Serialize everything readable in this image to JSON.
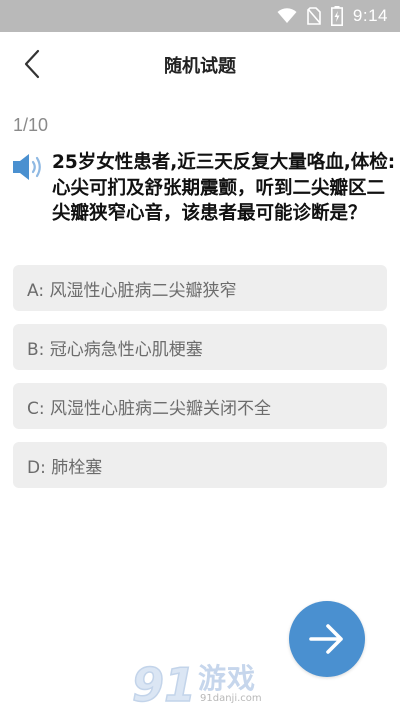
{
  "status_bar": {
    "time": "9:14",
    "icons": [
      "wifi-icon",
      "no-sim-icon",
      "battery-charging-icon"
    ]
  },
  "header": {
    "back_icon": "chevron-left-icon",
    "title": "随机试题"
  },
  "quiz": {
    "progress": "1/10",
    "speaker_icon": "speaker-icon",
    "question": "25岁女性患者,近三天反复大量咯血,体检:心尖可扪及舒张期震颤，听到二尖瓣区二尖瓣狭窄心音，该患者最可能诊断是？",
    "options": [
      {
        "label": "A: 风湿性心脏病二尖瓣狭窄"
      },
      {
        "label": "B: 冠心病急性心肌梗塞"
      },
      {
        "label": "C: 风湿性心脏病二尖瓣关闭不全"
      },
      {
        "label": "D: 肺栓塞"
      }
    ],
    "next_icon": "arrow-right-icon"
  },
  "watermark": {
    "logo_text": "91",
    "text": "游戏",
    "url": "91danji.com"
  },
  "colors": {
    "status_bar_bg": "#b9b9b9",
    "accent": "#4a90d0",
    "option_bg": "#eeeeee"
  }
}
